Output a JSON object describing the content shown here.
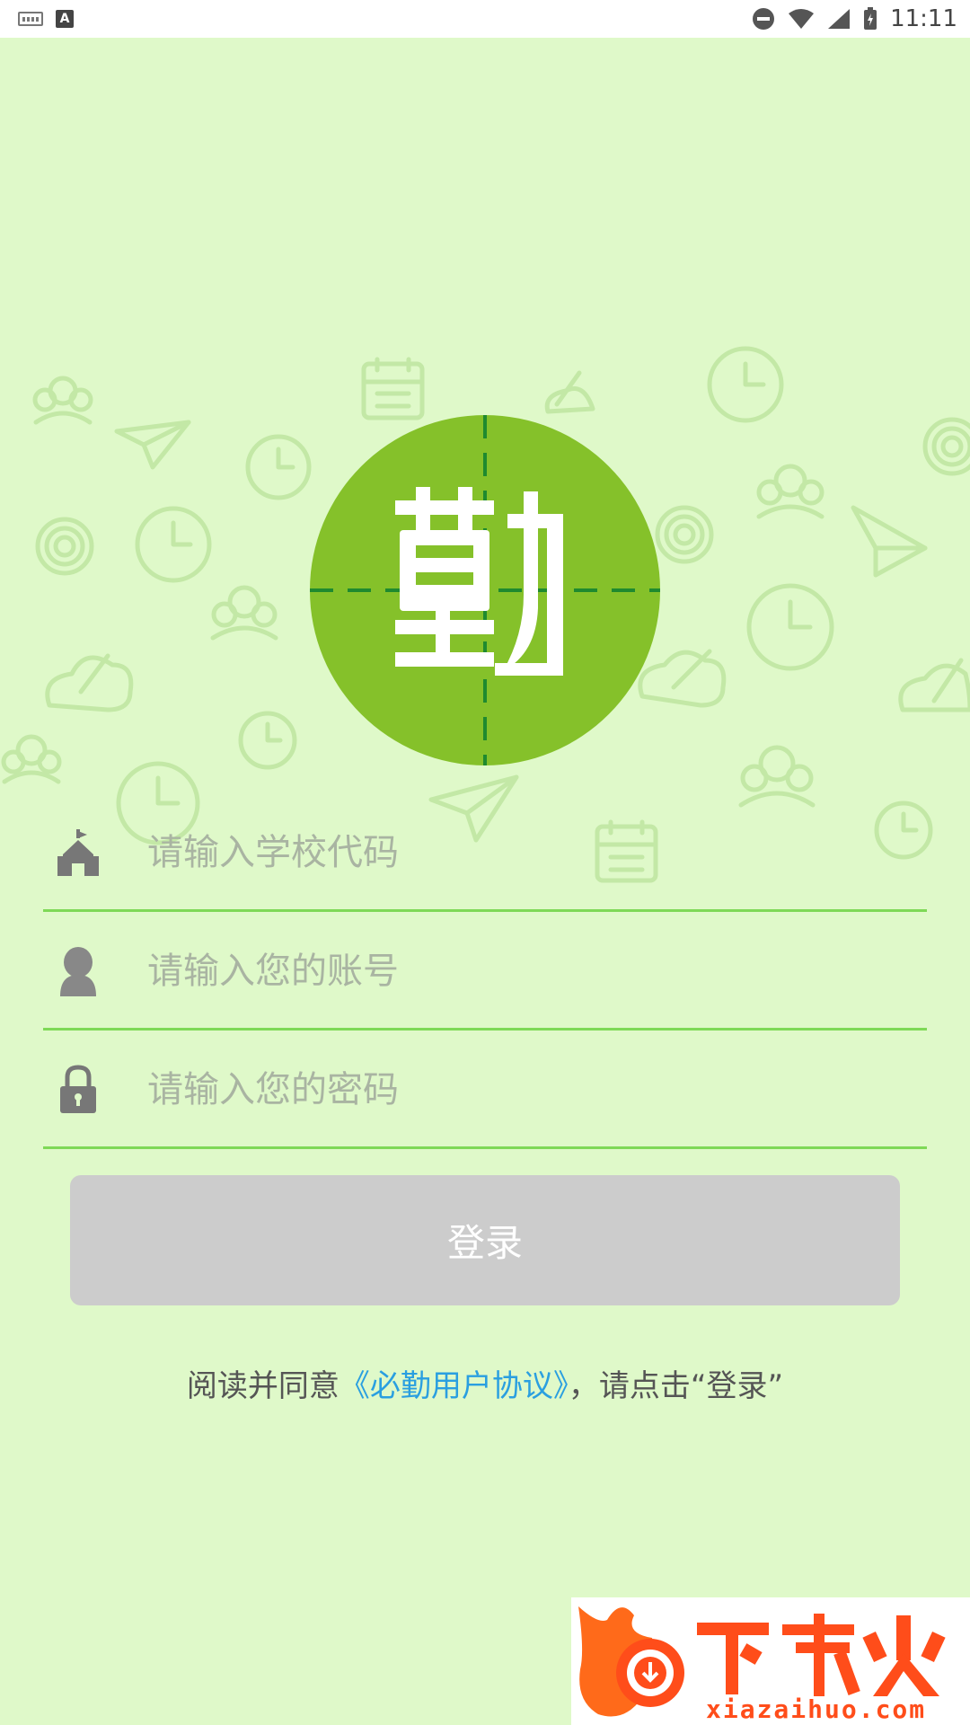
{
  "status_bar": {
    "time": "11:11"
  },
  "form": {
    "school_code_placeholder": "请输入学校代码",
    "account_placeholder": "请输入您的账号",
    "password_placeholder": "请输入您的密码",
    "login_label": "登录"
  },
  "agreement": {
    "prefix": "阅读并同意",
    "link": "《必勤用户协议》",
    "suffix": "，请点击“登录”"
  },
  "logo": {
    "char": "勤"
  },
  "watermark": {
    "brand": "下载火",
    "url": "xiazaihuo.com"
  },
  "colors": {
    "background": "#dff9c9",
    "accent_green": "#7ed957",
    "logo_green": "#85c12a",
    "link_blue": "#2a9fe0",
    "button_disabled": "#cccccc"
  }
}
